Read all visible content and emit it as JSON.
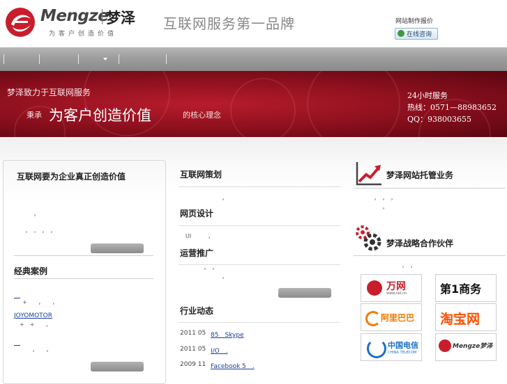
{
  "header": {
    "logo_en": "Mengze",
    "logo_cn": "梦泽",
    "logo_tagline": "为客户创造价值",
    "slogan": "互联网服务第一品牌",
    "quote_link": "网站制作报价",
    "consult_button": "在线咨询"
  },
  "banner": {
    "line1": "梦泽致力于互联网服务",
    "line2_prefix": "秉承",
    "line2_main": "为客户创造价值",
    "line2_suffix": "的核心理念",
    "service_hours": "24小时服务",
    "hotline": "热线：0571—88983652",
    "qq": "QQ：938003655"
  },
  "left_panel": {
    "title": "互联网要为企业真正创造价值",
    "frag_1": "，",
    "frag_2": "，　，　，　，",
    "cases_title": "经典案例",
    "case_link_1": "　",
    "case_desc_1": "+　　，　　，",
    "case_link_2": "JOYOMOTOR",
    "case_desc_2": "+　+　　，",
    "case_link_3": "　",
    "case_desc_3": "，　　，"
  },
  "middle": {
    "section1_title": "互联网策划",
    "section1_frag": "，",
    "section2_title": "网页设计",
    "section2_frag": "UI　　　，",
    "section3_title": "运营推广",
    "section3_frag_a": "，　，",
    "section3_frag_b": "，",
    "news_title": "行业动态",
    "news": [
      {
        "date": "2011 05",
        "text": "85　Skype"
      },
      {
        "date": "2011 05",
        "text": "I/O　."
      },
      {
        "date": "2009 11",
        "text": "Facebook 5　."
      }
    ]
  },
  "right": {
    "hosting_title": "梦泽网站托管业务",
    "hosting_frag_a": "，　，　，",
    "hosting_frag_b": "，",
    "partner_title": "梦泽战略合作伙伴",
    "partner_frag": "，　，",
    "partners": [
      "万网",
      "第1商务",
      "阿里巴巴",
      "淘宝网",
      "中国电信",
      "Mengze梦泽"
    ],
    "partner_sub": [
      "www.net.cn",
      "CHINA TELECOM"
    ]
  },
  "colors": {
    "banner_red": "#8a0f1d",
    "brand_red": "#c81e2c",
    "link_blue": "#1a3e9c"
  }
}
